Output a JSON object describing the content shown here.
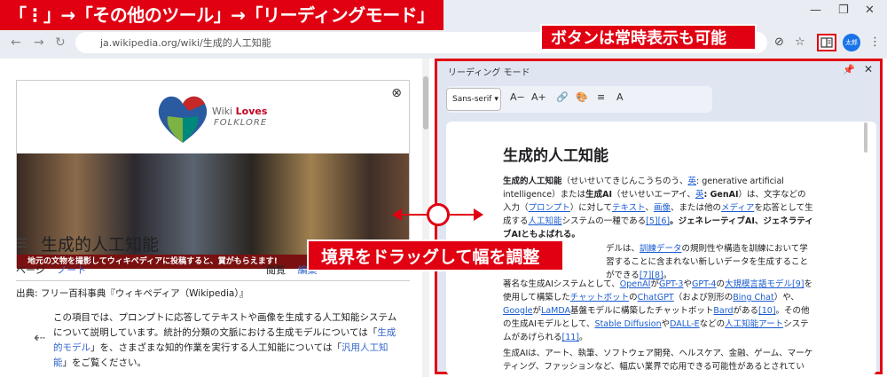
{
  "browser": {
    "url": "ja.wikipedia.org/wiki/生成的人工知能",
    "avatar_text": "太郎"
  },
  "callouts": {
    "menu_path": "「⋮」→「その他のツール」→「リーディングモード」",
    "button_note": "ボタンは常時表示も可能",
    "drag_note": "境界をドラッグして幅を調整"
  },
  "wiki": {
    "banner_brand_1": "Wiki",
    "banner_brand_2": "Loves",
    "banner_brand_3": "FOLKLORE",
    "banner_strip": "地元の文物を撮影してウィキペディアに投稿すると、賞がもらえます!",
    "page_title": "生成的人工知能",
    "tabs": [
      "ページ",
      "ノート"
    ],
    "tabs_right": [
      "閲覧",
      "編集"
    ],
    "source": "出典: フリー百科事典『ウィキペディア（Wikipedia）』",
    "hatnote_1": "この項目では、プロンプトに応答してテキストや画像を生成する人工知能システムについて説明しています。統計的分類の文脈における生成モデルについては「",
    "hatnote_link_1": "生成的モデル",
    "hatnote_2": "」を、さまざまな知的作業を実行する人工知能については「",
    "hatnote_link_2": "汎用人工知能",
    "hatnote_3": "」をご覧ください。"
  },
  "reading": {
    "panel_title": "リーディング モード",
    "font": "Sans-serif",
    "toolbar": [
      "A−",
      "A+",
      "🔗",
      "🎨",
      "≡",
      "A"
    ],
    "heading": "生成的人工知能",
    "p1_parts": [
      {
        "t": "生成的人工知能",
        "s": "b"
      },
      {
        "t": "（せいせいてきじんこうちのう、",
        "s": ""
      },
      {
        "t": "英",
        "s": "link"
      },
      {
        "t": ": generative artificial intelligence）または",
        "s": ""
      },
      {
        "t": "生成AI",
        "s": "b"
      },
      {
        "t": "（せいせいエーアイ、",
        "s": ""
      },
      {
        "t": "英",
        "s": "link"
      },
      {
        "t": ": GenAI",
        "s": "b"
      },
      {
        "t": "）は、文字などの入力（",
        "s": ""
      },
      {
        "t": "プロンプト",
        "s": "link"
      },
      {
        "t": "）に対して",
        "s": ""
      },
      {
        "t": "テキスト",
        "s": "link"
      },
      {
        "t": "、",
        "s": ""
      },
      {
        "t": "画像",
        "s": "link"
      },
      {
        "t": "、または他の",
        "s": ""
      },
      {
        "t": "メディア",
        "s": "link"
      },
      {
        "t": "を応答として生成する",
        "s": ""
      },
      {
        "t": "人工知能",
        "s": "link"
      },
      {
        "t": "システムの一種である",
        "s": ""
      },
      {
        "t": "[5][6]",
        "s": "link"
      },
      {
        "t": "。ジェネレーティブAI、ジェネラティブAIともよばれる。",
        "s": "b"
      }
    ],
    "p2_parts": [
      {
        "t": "デルは、",
        "s": ""
      },
      {
        "t": "訓練データ",
        "s": "link"
      },
      {
        "t": "の規則性や構造を訓練において学習することに含まれない新しいデータを生成することができる",
        "s": ""
      },
      {
        "t": "[7][8]",
        "s": "link"
      },
      {
        "t": "。",
        "s": ""
      }
    ],
    "p3_parts": [
      {
        "t": "著名な生成AIシステムとして、",
        "s": ""
      },
      {
        "t": "OpenAI",
        "s": "link"
      },
      {
        "t": "が",
        "s": ""
      },
      {
        "t": "GPT-3",
        "s": "link"
      },
      {
        "t": "や",
        "s": ""
      },
      {
        "t": "GPT-4",
        "s": "link"
      },
      {
        "t": "の",
        "s": ""
      },
      {
        "t": "大規模言語モデル",
        "s": "link"
      },
      {
        "t": "[9]",
        "s": "link"
      },
      {
        "t": "を使用して構築した",
        "s": ""
      },
      {
        "t": "チャットボット",
        "s": "link"
      },
      {
        "t": "の",
        "s": ""
      },
      {
        "t": "ChatGPT",
        "s": "link"
      },
      {
        "t": "（および別形の",
        "s": ""
      },
      {
        "t": "Bing Chat",
        "s": "link"
      },
      {
        "t": "）や、",
        "s": ""
      },
      {
        "t": "Google",
        "s": "link"
      },
      {
        "t": "が",
        "s": ""
      },
      {
        "t": "LaMDA",
        "s": "link"
      },
      {
        "t": "基盤モデルに構築したチャットボット",
        "s": ""
      },
      {
        "t": "Bard",
        "s": "link"
      },
      {
        "t": "がある",
        "s": ""
      },
      {
        "t": "[10]",
        "s": "link"
      },
      {
        "t": "。その他の生成AIモデルとして、",
        "s": ""
      },
      {
        "t": "Stable Diffusion",
        "s": "link"
      },
      {
        "t": "や",
        "s": ""
      },
      {
        "t": "DALL-E",
        "s": "link"
      },
      {
        "t": "などの",
        "s": ""
      },
      {
        "t": "人工知能アート",
        "s": "link"
      },
      {
        "t": "システムがあげられる",
        "s": ""
      },
      {
        "t": "[11]",
        "s": "link"
      },
      {
        "t": "。",
        "s": ""
      }
    ],
    "p4": "生成AIは、アート、執筆、ソフトウェア開発、ヘルスケア、金融、ゲーム、マーケティング、ファッションなど、幅広い業界で応用できる可能性があるとされてい"
  },
  "colors": {
    "callout": "#e00012",
    "link": "#1a5cd0"
  }
}
